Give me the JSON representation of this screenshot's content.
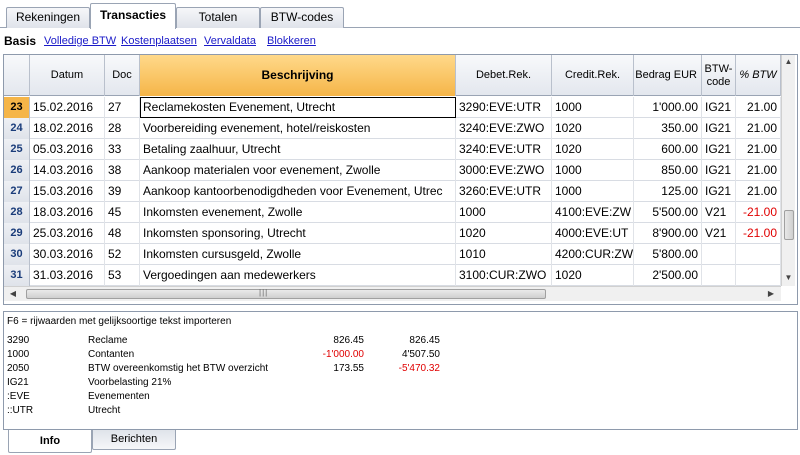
{
  "tabs": [
    "Rekeningen",
    "Transacties",
    "Totalen",
    "BTW-codes"
  ],
  "views": [
    "Basis",
    "Volledige BTW",
    "Kostenplaatsen",
    "Vervaldata",
    "Blokkeren"
  ],
  "columns": {
    "datum": "Datum",
    "doc": "Doc",
    "beschrijving": "Beschrijving",
    "debet": "Debet.Rek.",
    "credit": "Credit.Rek.",
    "bedrag": "Bedrag EUR",
    "btw_code": "BTW-code",
    "btw_pct": "% BTW"
  },
  "rows": [
    {
      "nr": "23",
      "datum": "15.02.2016",
      "doc": "27",
      "beschrijving": "Reclamekosten Evenement, Utrecht",
      "debet": "3290:EVE:UTR",
      "credit": "1000",
      "bedrag": "1'000.00",
      "btw_code": "IG21",
      "btw_pct": "21.00"
    },
    {
      "nr": "24",
      "datum": "18.02.2016",
      "doc": "28",
      "beschrijving": "Voorbereiding evenement, hotel/reiskosten",
      "debet": "3240:EVE:ZWO",
      "credit": "1020",
      "bedrag": "350.00",
      "btw_code": "IG21",
      "btw_pct": "21.00"
    },
    {
      "nr": "25",
      "datum": "05.03.2016",
      "doc": "33",
      "beschrijving": "Betaling zaalhuur, Utrecht",
      "debet": "3240:EVE:UTR",
      "credit": "1020",
      "bedrag": "600.00",
      "btw_code": "IG21",
      "btw_pct": "21.00"
    },
    {
      "nr": "26",
      "datum": "14.03.2016",
      "doc": "38",
      "beschrijving": "Aankoop materialen voor evenement, Zwolle",
      "debet": "3000:EVE:ZWO",
      "credit": "1000",
      "bedrag": "850.00",
      "btw_code": "IG21",
      "btw_pct": "21.00"
    },
    {
      "nr": "27",
      "datum": "15.03.2016",
      "doc": "39",
      "beschrijving": "Aankoop kantoorbenodigdheden voor Evenement, Utrec",
      "debet": "3260:EVE:UTR",
      "credit": "1000",
      "bedrag": "125.00",
      "btw_code": "IG21",
      "btw_pct": "21.00"
    },
    {
      "nr": "28",
      "datum": "18.03.2016",
      "doc": "45",
      "beschrijving": "Inkomsten evenement, Zwolle",
      "debet": "1000",
      "credit": "4100:EVE:ZW",
      "bedrag": "5'500.00",
      "btw_code": "V21",
      "btw_pct": "-21.00"
    },
    {
      "nr": "29",
      "datum": "25.03.2016",
      "doc": "48",
      "beschrijving": "Inkomsten sponsoring, Utrecht",
      "debet": "1020",
      "credit": "4000:EVE:UT",
      "bedrag": "8'900.00",
      "btw_code": "V21",
      "btw_pct": "-21.00"
    },
    {
      "nr": "30",
      "datum": "30.03.2016",
      "doc": "52",
      "beschrijving": "Inkomsten cursusgeld, Zwolle",
      "debet": "1010",
      "credit": "4200:CUR:ZW",
      "bedrag": "5'800.00",
      "btw_code": "",
      "btw_pct": ""
    },
    {
      "nr": "31",
      "datum": "31.03.2016",
      "doc": "53",
      "beschrijving": "Vergoedingen aan medewerkers",
      "debet": "3100:CUR:ZWO",
      "credit": "1020",
      "bedrag": "2'500.00",
      "btw_code": "",
      "btw_pct": ""
    }
  ],
  "info": {
    "hint": "F6 = rijwaarden met gelijksoortige tekst importeren",
    "lines": [
      {
        "code": "3290",
        "desc": "Reclame",
        "v1": "826.45",
        "v2": "826.45"
      },
      {
        "code": "1000",
        "desc": "Contanten",
        "v1": "-1'000.00",
        "v2": "4'507.50"
      },
      {
        "code": "2050",
        "desc": "BTW overeenkomstig het BTW overzicht",
        "v1": "173.55",
        "v2": "-5'470.32"
      },
      {
        "code": "IG21",
        "desc": "Voorbelasting 21%",
        "v1": "",
        "v2": ""
      },
      {
        "code": ":EVE",
        "desc": "Evenementen",
        "v1": "",
        "v2": ""
      },
      {
        "code": "::UTR",
        "desc": "Utrecht",
        "v1": "",
        "v2": ""
      }
    ]
  },
  "bottom_tabs": [
    "Info",
    "Berichten"
  ],
  "colors": {
    "header_highlight": "#f5b548",
    "negative": "#e00000",
    "link": "#1a1ac8"
  }
}
